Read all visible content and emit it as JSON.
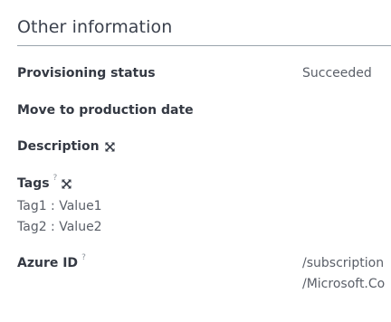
{
  "section": {
    "title": "Other information"
  },
  "fields": {
    "provisioning_status": {
      "label": "Provisioning status",
      "value": "Succeeded"
    },
    "move_to_production": {
      "label": "Move to production date"
    },
    "description": {
      "label": "Description",
      "icon": "expand-icon"
    },
    "tags": {
      "label": "Tags",
      "help": "?",
      "icon": "expand-icon",
      "items": [
        {
          "key": "Tag1",
          "sep": " : ",
          "value": "Value1"
        },
        {
          "key": "Tag2",
          "sep": " : ",
          "value": "Value2"
        }
      ]
    },
    "azure_id": {
      "label": "Azure ID",
      "help": "?",
      "value_line1": "/subscription",
      "value_line2": "/Microsoft.Co"
    }
  }
}
